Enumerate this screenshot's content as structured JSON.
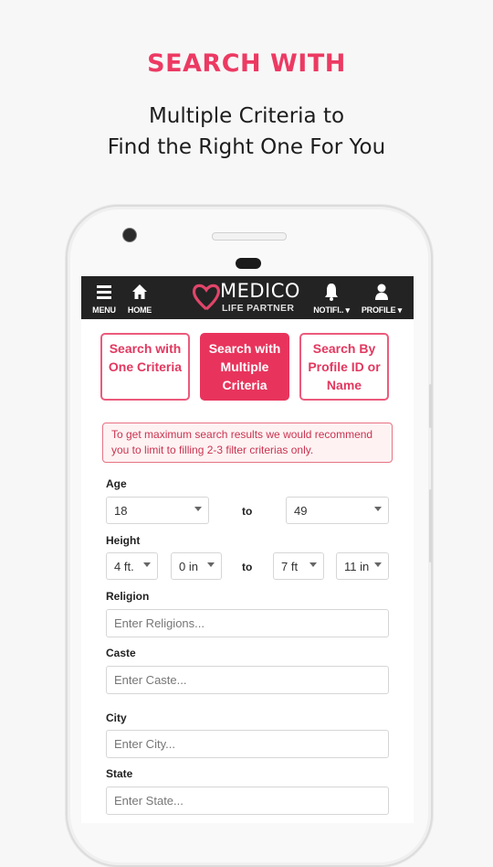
{
  "promo": {
    "headline": "SEARCH WITH",
    "line1": "Multiple Criteria to",
    "line2": "Find the Right One For You"
  },
  "colors": {
    "accent": "#e8345c",
    "topbar": "#232323"
  },
  "app": {
    "topbar": {
      "menu_label": "MENU",
      "menu_icon": "hamburger-icon",
      "home_label": "HOME",
      "home_icon": "home-icon",
      "logo_top": "MEDICO",
      "logo_bottom": "LIFE PARTNER",
      "notifications_label": "NOTIFI..",
      "notifications_icon": "bell-icon",
      "profile_label": "PROFILE",
      "profile_icon": "user-icon"
    },
    "tabs": [
      {
        "label": "Search with One Criteria",
        "active": false
      },
      {
        "label": "Search with Multiple Criteria",
        "active": true
      },
      {
        "label": "Search By Profile ID or Name",
        "active": false
      }
    ],
    "alert": "To get maximum search results we would recommend you to limit to filling 2-3 filter criterias only.",
    "form": {
      "age": {
        "label": "Age",
        "from": "18",
        "to_label": "to",
        "to": "49"
      },
      "height": {
        "label": "Height",
        "from_ft": "4 ft.",
        "from_in": "0 in",
        "to_label": "to",
        "to_ft": "7 ft",
        "to_in": "11 in"
      },
      "religion": {
        "label": "Religion",
        "placeholder": "Enter Religions..."
      },
      "caste": {
        "label": "Caste",
        "placeholder": "Enter Caste..."
      },
      "city": {
        "label": "City",
        "placeholder": "Enter City..."
      },
      "state": {
        "label": "State",
        "placeholder": "Enter State..."
      }
    }
  }
}
